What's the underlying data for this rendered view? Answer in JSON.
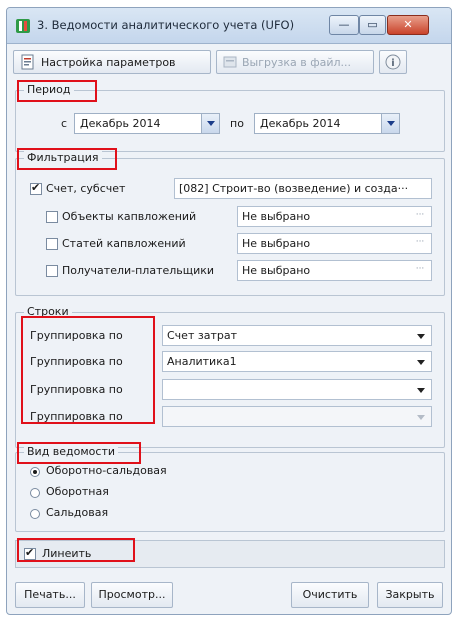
{
  "window": {
    "title": "3. Ведомости аналитического учета (UFO)",
    "minimize_glyph": "—",
    "maximize_glyph": "▭",
    "close_glyph": "✕"
  },
  "toolbar": {
    "settings_label": "Настройка параметров",
    "export_label": "Выгрузка в файл...",
    "info_glyph": "i"
  },
  "period": {
    "title": "Период",
    "from_label": "с",
    "from_value": "Декабрь 2014",
    "to_label": "по",
    "to_value": "Декабрь 2014"
  },
  "filters": {
    "title": "Фильтрация",
    "items": [
      {
        "label": "Счет, субсчет",
        "checked": true,
        "value": "[082] Строит-во (возведение) и созда···"
      },
      {
        "label": "Объекты капвложений",
        "checked": false,
        "value": "Не выбрано"
      },
      {
        "label": "Статей капвложений",
        "checked": false,
        "value": "Не выбрано"
      },
      {
        "label": "Получатели-плательщики",
        "checked": false,
        "value": "Не выбрано"
      }
    ],
    "ellipsis": "···"
  },
  "rows": {
    "title": "Строки",
    "items": [
      {
        "label": "Группировка по",
        "value": "Счет затрат"
      },
      {
        "label": "Группировка по",
        "value": "Аналитика1"
      },
      {
        "label": "Группировка по",
        "value": ""
      },
      {
        "label": "Группировка по",
        "value": ""
      }
    ]
  },
  "kind": {
    "title": "Вид ведомости",
    "options": [
      "Оборотно-сальдовая",
      "Оборотная",
      "Сальдовая"
    ],
    "selected": "Оборотно-сальдовая"
  },
  "lines": {
    "label": "Линеить",
    "checked": true
  },
  "buttons": {
    "print": "Печать...",
    "preview": "Просмотр...",
    "clear": "Очистить",
    "close": "Закрыть"
  },
  "colors": {
    "highlight": "#e0101a",
    "accent": "#1b3d8a",
    "window_bg": "#eef2f7"
  }
}
